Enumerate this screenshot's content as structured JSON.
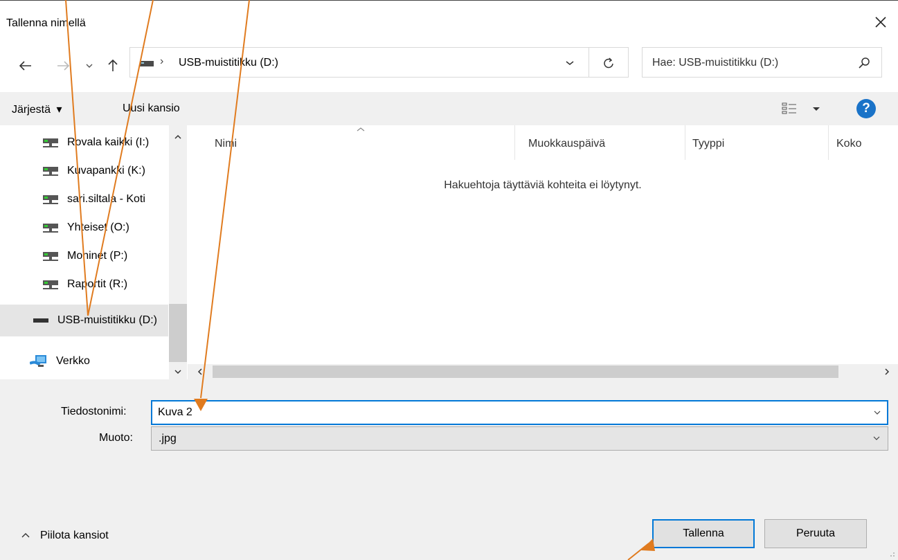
{
  "dialog": {
    "title": "Tallenna nimellä",
    "close_icon": "close-icon"
  },
  "nav": {
    "back_icon": "back-arrow-icon",
    "forward_icon": "forward-arrow-icon",
    "recent_icon": "chevron-down-icon",
    "up_icon": "up-arrow-icon"
  },
  "address": {
    "path_label": "USB-muistitikku (D:)",
    "drive_icon": "usb-drive-icon",
    "separator": "›",
    "dropdown_icon": "chevron-down-icon",
    "refresh_icon": "refresh-icon"
  },
  "search": {
    "placeholder": "Hae: USB-muistitikku (D:)",
    "icon": "search-icon"
  },
  "toolbar": {
    "organize_label": "Järjestä",
    "organize_caret": "▾",
    "new_folder_label": "Uusi kansio",
    "view_icon": "view-options-icon",
    "help_icon": "help-icon",
    "help_glyph": "?"
  },
  "sidebar": {
    "items": [
      {
        "label": "Rovala kaikki (I:)",
        "icon": "network-drive-icon"
      },
      {
        "label": "Kuvapankki (K:)",
        "icon": "network-drive-icon"
      },
      {
        "label": "sari.siltala - Koti",
        "icon": "network-drive-icon"
      },
      {
        "label": "Yhteiset (O:)",
        "icon": "network-drive-icon"
      },
      {
        "label": "Moninet (P:)",
        "icon": "network-drive-icon"
      },
      {
        "label": "Raportit (R:)",
        "icon": "network-drive-icon"
      },
      {
        "label": "USB-muistitikku (D:)",
        "icon": "usb-drive-icon",
        "selected": true
      },
      {
        "label": "Verkko",
        "icon": "network-icon"
      }
    ]
  },
  "file_list": {
    "columns": [
      "Nimi",
      "Muokkauspäivä",
      "Tyyppi",
      "Koko"
    ],
    "sorted_column": "Nimi",
    "empty_message": "Hakuehtoja täyttäviä kohteita ei löytynyt."
  },
  "form": {
    "filename_label": "Tiedostonimi:",
    "filename_value": "Kuva 2",
    "type_label": "Muoto:",
    "type_value": ".jpg"
  },
  "footer": {
    "hide_folders_label": "Piilota kansiot",
    "save_label": "Tallenna",
    "cancel_label": "Peruuta"
  },
  "colors": {
    "accent": "#0078d7",
    "annotation_arrow": "#e07b1f",
    "help_blue": "#1a73c8"
  }
}
